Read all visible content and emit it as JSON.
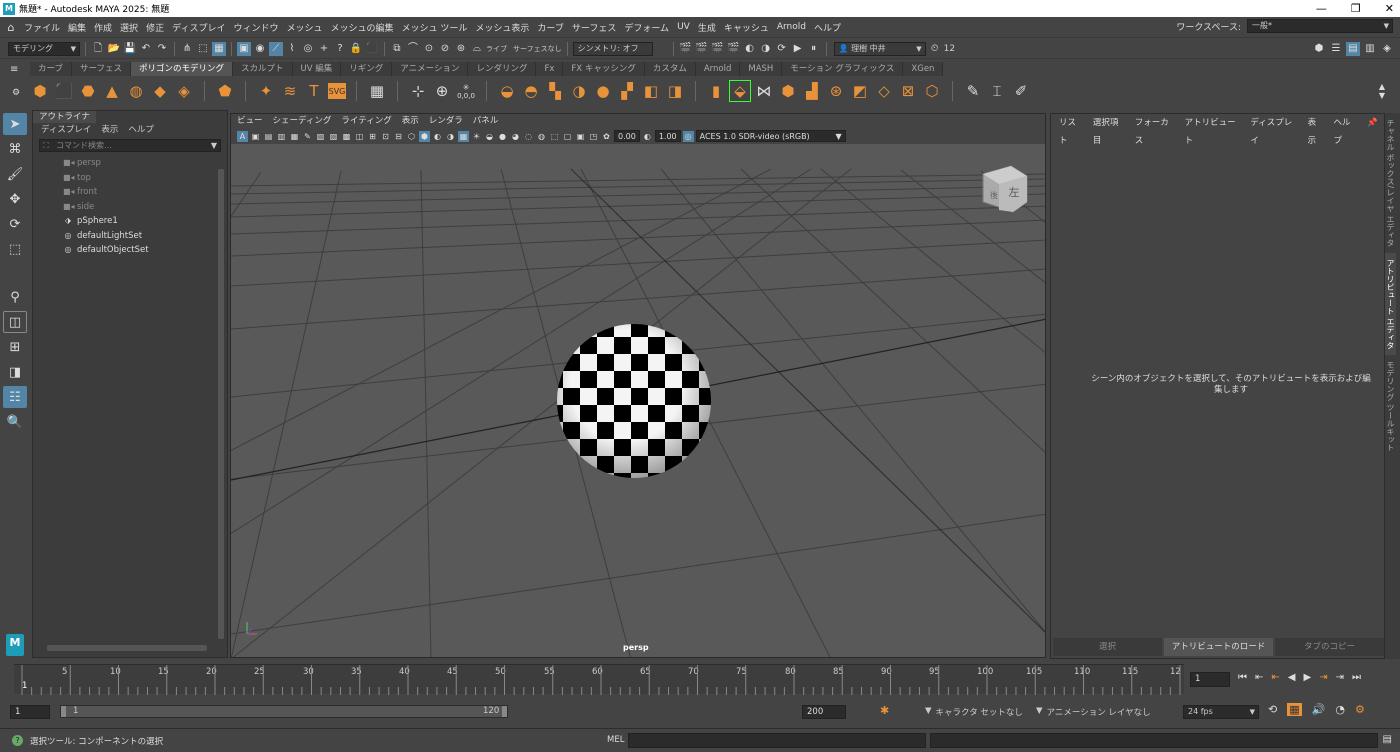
{
  "titlebar": {
    "title": "無題* - Autodesk MAYA 2025: 無題",
    "logo": "M",
    "minimize": "—",
    "restore": "❐",
    "close": "✕"
  },
  "menubar": {
    "items": [
      "ファイル",
      "編集",
      "作成",
      "選択",
      "修正",
      "ディスプレイ",
      "ウィンドウ",
      "メッシュ",
      "メッシュの編集",
      "メッシュ ツール",
      "メッシュ表示",
      "カーブ",
      "サーフェス",
      "デフォーム",
      "UV",
      "生成",
      "キャッシュ",
      "Arnold",
      "ヘルプ"
    ],
    "workspace_label": "ワークスペース:",
    "workspace_value": "一般*"
  },
  "statusline": {
    "mode": "モデリング",
    "live_label": "ライブ",
    "surface_label": "サーフェスなし",
    "symmetry": "シンメトリ: オフ",
    "user": "理樹 中井",
    "notifications": "12"
  },
  "shelf": {
    "tabs": [
      "カーブ",
      "サーフェス",
      "ポリゴンのモデリング",
      "スカルプト",
      "UV 編集",
      "リギング",
      "アニメーション",
      "レンダリング",
      "Fx",
      "FX キャッシング",
      "カスタム",
      "Arnold",
      "MASH",
      "モーション グラフィックス",
      "XGen"
    ],
    "active_tab": "ポリゴンのモデリング",
    "origin_label": "0,0,0"
  },
  "outliner": {
    "tab": "アウトライナ",
    "menu": [
      "ディスプレイ",
      "表示",
      "ヘルプ"
    ],
    "search_placeholder": "コマンド検索...",
    "items": [
      {
        "label": "persp",
        "dim": true
      },
      {
        "label": "top",
        "dim": true
      },
      {
        "label": "front",
        "dim": true
      },
      {
        "label": "side",
        "dim": true
      },
      {
        "label": "pSphere1",
        "dim": false
      },
      {
        "label": "defaultLightSet",
        "dim": false
      },
      {
        "label": "defaultObjectSet",
        "dim": false
      }
    ]
  },
  "viewport": {
    "menu": [
      "ビュー",
      "シェーディング",
      "ライティング",
      "表示",
      "レンダラ",
      "パネル"
    ],
    "exposure": "0.00",
    "gamma": "1.00",
    "colorspace": "ACES 1.0 SDR-video (sRGB)",
    "camera": "persp",
    "viewcube_label": "左",
    "viewcube_side": "後"
  },
  "attribute_editor": {
    "menu": [
      "リスト",
      "選択項目",
      "フォーカス",
      "アトリビュート",
      "ディスプレイ",
      "表示",
      "ヘルプ"
    ],
    "message": "シーン内のオブジェクトを選択して、そのアトリビュートを表示および編集します",
    "buttons": [
      "選択",
      "アトリビュートのロード",
      "タブのコピー"
    ],
    "side_tabs": [
      "チャネル ボックス/レイヤ エディタ",
      "アトリビュート エディタ",
      "モデリング ツールキット"
    ]
  },
  "timeline": {
    "labels": [
      "5",
      "10",
      "15",
      "20",
      "25",
      "30",
      "35",
      "40",
      "45",
      "50",
      "55",
      "60",
      "65",
      "70",
      "75",
      "80",
      "85",
      "90",
      "95",
      "100",
      "105",
      "110",
      "115",
      "12"
    ],
    "current": "1",
    "current_frame": "1"
  },
  "range": {
    "start": "1",
    "inner_start": "1",
    "inner_end": "120",
    "end": "200",
    "character_set": "キャラクタ セットなし",
    "anim_layer": "アニメーション レイヤなし",
    "fps": "24 fps"
  },
  "cmdline": {
    "help": "選択ツール: コンポーネントの選択",
    "lang": "MEL"
  }
}
